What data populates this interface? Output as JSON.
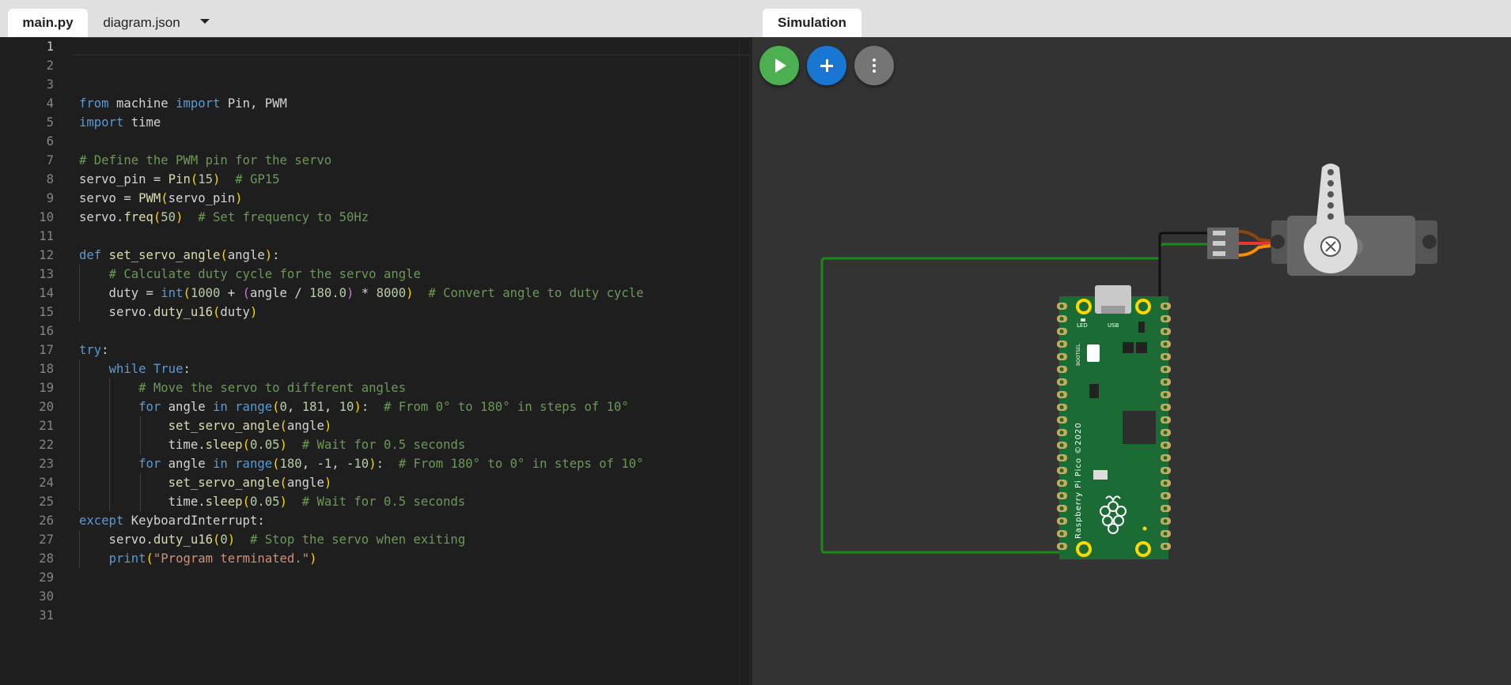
{
  "editor": {
    "tabs": [
      {
        "label": "main.py",
        "active": true
      },
      {
        "label": "diagram.json",
        "active": false
      }
    ],
    "current_line": 1,
    "lines": [
      "",
      "",
      "",
      "from machine import Pin, PWM",
      "import time",
      "",
      "# Define the PWM pin for the servo",
      "servo_pin = Pin(15)  # GP15",
      "servo = PWM(servo_pin)",
      "servo.freq(50)  # Set frequency to 50Hz",
      "",
      "def set_servo_angle(angle):",
      "    # Calculate duty cycle for the servo angle",
      "    duty = int(1000 + (angle / 180.0) * 8000)  # Convert angle to duty cycle",
      "    servo.duty_u16(duty)",
      "",
      "try:",
      "    while True:",
      "        # Move the servo to different angles",
      "        for angle in range(0, 181, 10):  # From 0° to 180° in steps of 10°",
      "            set_servo_angle(angle)",
      "            time.sleep(0.05)  # Wait for 0.5 seconds",
      "        for angle in range(180, -1, -10):  # From 180° to 0° in steps of 10°",
      "            set_servo_angle(angle)",
      "            time.sleep(0.05)  # Wait for 0.5 seconds",
      "except KeyboardInterrupt:",
      "    servo.duty_u16(0)  # Stop the servo when exiting",
      "    print(\"Program terminated.\")",
      "",
      "",
      ""
    ]
  },
  "simulation": {
    "tab_label": "Simulation",
    "buttons": [
      {
        "name": "start-simulation",
        "icon": "play-icon",
        "color": "#4caf50"
      },
      {
        "name": "add-part",
        "icon": "plus-icon",
        "color": "#1976d2"
      },
      {
        "name": "more-options",
        "icon": "more-vertical-icon",
        "color": "#757575"
      }
    ],
    "board": {
      "brand_text": "Raspberry Pi Pico ©2020",
      "usb_label": "USB",
      "led_label": "LED",
      "bootsel_label": "BOOTSEL",
      "color": "#1b6b34"
    },
    "wires": {
      "signal": "#1a8a1a",
      "ground": "#111111",
      "power": "#e53935",
      "servo_orange": "#ff8c00",
      "servo_brown": "#8b4513"
    }
  }
}
